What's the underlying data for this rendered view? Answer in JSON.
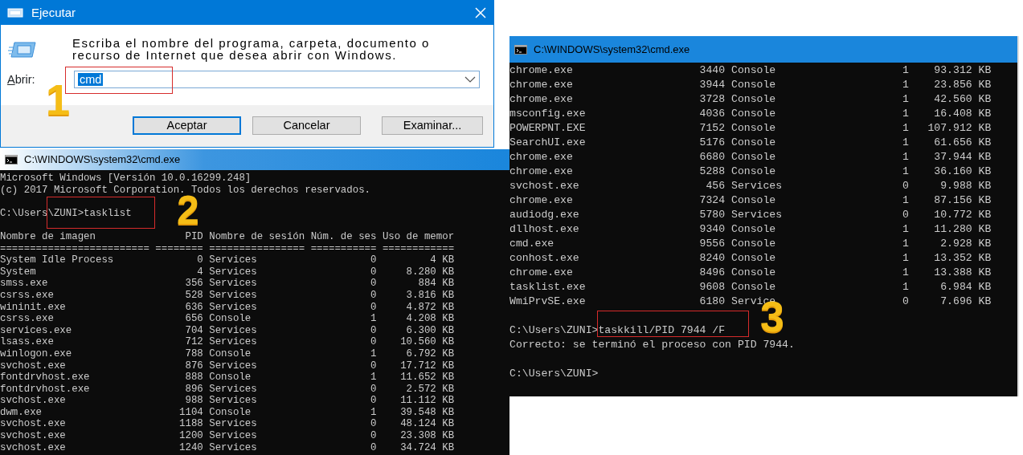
{
  "run_dialog": {
    "title": "Ejecutar",
    "description": "Escriba el nombre del programa, carpeta, documento o recurso de Internet que desea abrir con Windows.",
    "open_label": "Abrir:",
    "open_value": "cmd",
    "value_selected": true,
    "buttons": [
      {
        "label": "Aceptar",
        "default": true
      },
      {
        "label": "Cancelar",
        "default": false
      },
      {
        "label": "Examinar...",
        "default": false
      }
    ]
  },
  "console_windows": [
    {
      "title": "C:\\WINDOWS\\system32\\cmd.exe",
      "lines": [
        {
          "kind": "text",
          "text": "Microsoft Windows [Versión 10.0.16299.248]"
        },
        {
          "kind": "text",
          "text": "(c) 2017 Microsoft Corporation. Todos los derechos reservados."
        },
        {
          "kind": "blank"
        },
        {
          "kind": "text",
          "text": "C:\\Users\\ZUNI>tasklist"
        },
        {
          "kind": "blank"
        },
        {
          "kind": "header",
          "cells": [
            "Nombre de imagen",
            "PID",
            "Nombre de sesión",
            "Núm. de ses",
            "Uso de memor"
          ]
        },
        {
          "kind": "text",
          "text": "========================= ======== ================ =========== ============"
        },
        {
          "kind": "row",
          "cells": [
            "System Idle Process",
            "0",
            "Services",
            "0",
            "4 KB"
          ]
        },
        {
          "kind": "row",
          "cells": [
            "System",
            "4",
            "Services",
            "0",
            "8.280 KB"
          ]
        },
        {
          "kind": "row",
          "cells": [
            "smss.exe",
            "356",
            "Services",
            "0",
            "884 KB"
          ]
        },
        {
          "kind": "row",
          "cells": [
            "csrss.exe",
            "528",
            "Services",
            "0",
            "3.816 KB"
          ]
        },
        {
          "kind": "row",
          "cells": [
            "wininit.exe",
            "636",
            "Services",
            "0",
            "4.872 KB"
          ]
        },
        {
          "kind": "row",
          "cells": [
            "csrss.exe",
            "656",
            "Console",
            "1",
            "4.208 KB"
          ]
        },
        {
          "kind": "row",
          "cells": [
            "services.exe",
            "704",
            "Services",
            "0",
            "6.300 KB"
          ]
        },
        {
          "kind": "row",
          "cells": [
            "lsass.exe",
            "712",
            "Services",
            "0",
            "10.560 KB"
          ]
        },
        {
          "kind": "row",
          "cells": [
            "winlogon.exe",
            "788",
            "Console",
            "1",
            "6.792 KB"
          ]
        },
        {
          "kind": "row",
          "cells": [
            "svchost.exe",
            "876",
            "Services",
            "0",
            "17.712 KB"
          ]
        },
        {
          "kind": "row",
          "cells": [
            "fontdrvhost.exe",
            "888",
            "Console",
            "1",
            "11.652 KB"
          ]
        },
        {
          "kind": "row",
          "cells": [
            "fontdrvhost.exe",
            "896",
            "Services",
            "0",
            "2.572 KB"
          ]
        },
        {
          "kind": "row",
          "cells": [
            "svchost.exe",
            "988",
            "Services",
            "0",
            "11.112 KB"
          ]
        },
        {
          "kind": "row",
          "cells": [
            "dwm.exe",
            "1104",
            "Console",
            "1",
            "39.548 KB"
          ]
        },
        {
          "kind": "row",
          "cells": [
            "svchost.exe",
            "1188",
            "Services",
            "0",
            "48.124 KB"
          ]
        },
        {
          "kind": "row",
          "cells": [
            "svchost.exe",
            "1200",
            "Services",
            "0",
            "23.308 KB"
          ]
        },
        {
          "kind": "row",
          "cells": [
            "svchost.exe",
            "1240",
            "Services",
            "0",
            "34.724 KB"
          ]
        }
      ]
    },
    {
      "title": "C:\\WINDOWS\\system32\\cmd.exe",
      "lines": [
        {
          "kind": "row",
          "cells": [
            "chrome.exe",
            "3440",
            "Console",
            "1",
            "93.312 KB"
          ]
        },
        {
          "kind": "row",
          "cells": [
            "chrome.exe",
            "3944",
            "Console",
            "1",
            "23.856 KB"
          ]
        },
        {
          "kind": "row",
          "cells": [
            "chrome.exe",
            "3728",
            "Console",
            "1",
            "42.560 KB"
          ]
        },
        {
          "kind": "row",
          "cells": [
            "msconfig.exe",
            "4036",
            "Console",
            "1",
            "16.408 KB"
          ]
        },
        {
          "kind": "row",
          "cells": [
            "POWERPNT.EXE",
            "7152",
            "Console",
            "1",
            "107.912 KB"
          ]
        },
        {
          "kind": "row",
          "cells": [
            "SearchUI.exe",
            "5176",
            "Console",
            "1",
            "61.656 KB"
          ]
        },
        {
          "kind": "row",
          "cells": [
            "chrome.exe",
            "6680",
            "Console",
            "1",
            "37.944 KB"
          ]
        },
        {
          "kind": "row",
          "cells": [
            "chrome.exe",
            "5288",
            "Console",
            "1",
            "36.160 KB"
          ]
        },
        {
          "kind": "row",
          "cells": [
            "svchost.exe",
            "456",
            "Services",
            "0",
            "9.988 KB"
          ]
        },
        {
          "kind": "row",
          "cells": [
            "chrome.exe",
            "7324",
            "Console",
            "1",
            "87.156 KB"
          ]
        },
        {
          "kind": "row",
          "cells": [
            "audiodg.exe",
            "5780",
            "Services",
            "0",
            "10.772 KB"
          ]
        },
        {
          "kind": "row",
          "cells": [
            "dllhost.exe",
            "9340",
            "Console",
            "1",
            "11.280 KB"
          ]
        },
        {
          "kind": "row",
          "cells": [
            "cmd.exe",
            "9556",
            "Console",
            "1",
            "2.928 KB"
          ]
        },
        {
          "kind": "row",
          "cells": [
            "conhost.exe",
            "8240",
            "Console",
            "1",
            "13.352 KB"
          ]
        },
        {
          "kind": "row",
          "cells": [
            "chrome.exe",
            "8496",
            "Console",
            "1",
            "13.388 KB"
          ]
        },
        {
          "kind": "row",
          "cells": [
            "tasklist.exe",
            "9608",
            "Console",
            "1",
            "6.984 KB"
          ]
        },
        {
          "kind": "row",
          "cells": [
            "WmiPrvSE.exe",
            "6180",
            "Service",
            "0",
            "7.696 KB"
          ]
        },
        {
          "kind": "blank"
        },
        {
          "kind": "text",
          "text": "C:\\Users\\ZUNI>taskkill/PID 7944 /F"
        },
        {
          "kind": "text",
          "text": "Correcto: se terminó el proceso con PID 7944."
        },
        {
          "kind": "blank"
        },
        {
          "kind": "text",
          "text": "C:\\Users\\ZUNI>"
        }
      ]
    }
  ],
  "annotations": [
    {
      "label": "1"
    },
    {
      "label": "2"
    },
    {
      "label": "3"
    }
  ]
}
